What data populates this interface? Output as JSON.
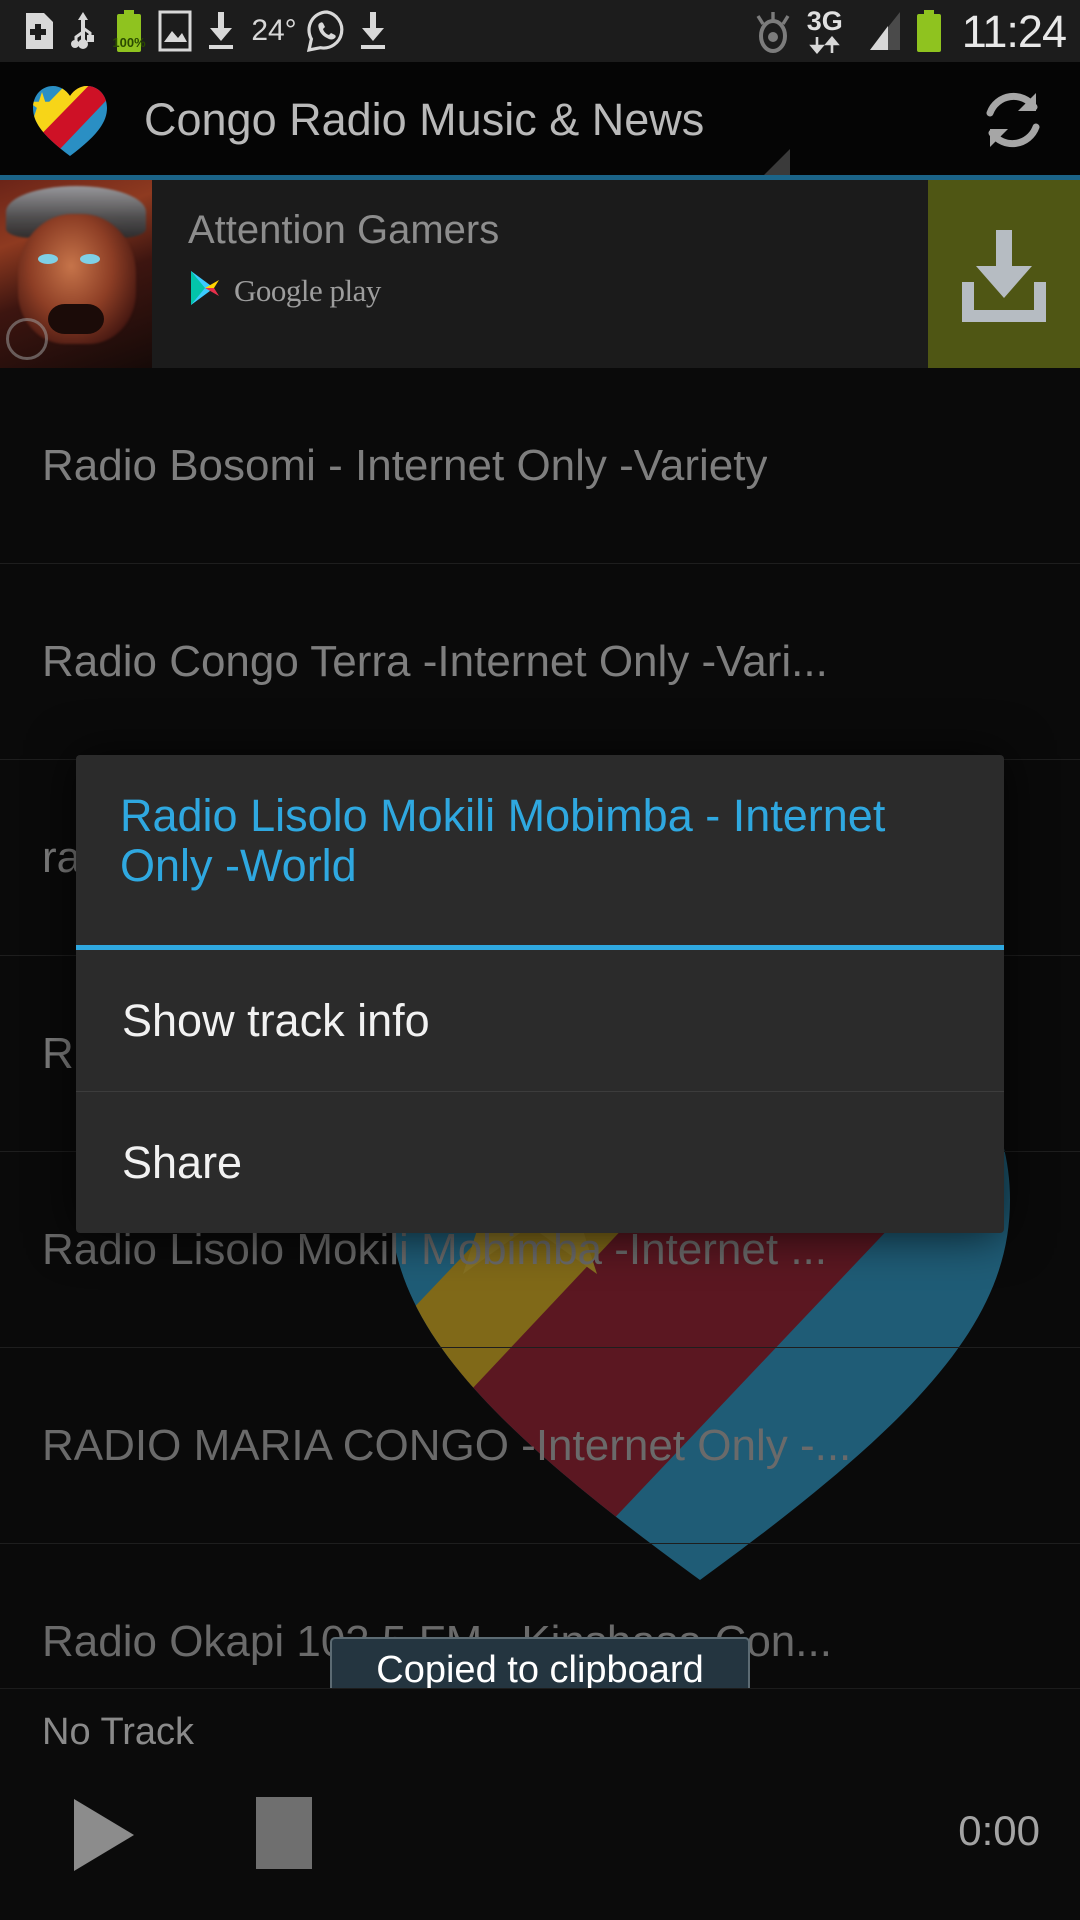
{
  "status_bar": {
    "time": "11:24",
    "network": "3G",
    "temperature": "24°",
    "battery_percent": "100%",
    "icons": [
      "sd-card-add-icon",
      "usb-icon",
      "battery-charging-icon",
      "screenshot-image-icon",
      "download-icon",
      "weather-temp-icon",
      "whatsapp-icon",
      "download-icon-2",
      "smart-stay-eye-icon",
      "3g-data-icon",
      "signal-bars-icon",
      "battery-icon"
    ]
  },
  "action_bar": {
    "title": "Congo Radio Music & News",
    "logo_icon": "congo-flag-heart-icon",
    "refresh_icon": "refresh-icon"
  },
  "ad_banner": {
    "headline": "Attention Gamers",
    "store_label": "Google play",
    "store_icon": "google-play-icon",
    "cta_icon": "download-icon",
    "cta_color": "#4f5614",
    "thumbnail_icon": "game-warrior-thumbnail"
  },
  "stations": [
    {
      "label": "Radio Bosomi - Internet Only -Variety"
    },
    {
      "label": "Radio Congo Terra -Internet Only -Vari..."
    },
    {
      "label": "ra"
    },
    {
      "label": "R"
    },
    {
      "label": "Radio Lisolo Mokili Mobimba -Internet ..."
    },
    {
      "label": "RADIO MARIA CONGO -Internet Only -..."
    },
    {
      "label": "Radio Okapi 103.5 FM - Kinshasa Con..."
    }
  ],
  "dialog": {
    "title": "Radio Lisolo Mokili Mobimba - Internet Only -World",
    "accent_color": "#2fa8e0",
    "items": [
      {
        "label": "Show track info"
      },
      {
        "label": "Share"
      }
    ]
  },
  "toast": {
    "message": "Copied to clipboard"
  },
  "player": {
    "track_label": "No Track",
    "elapsed": "0:00",
    "play_icon": "play-icon",
    "stop_icon": "stop-icon"
  }
}
